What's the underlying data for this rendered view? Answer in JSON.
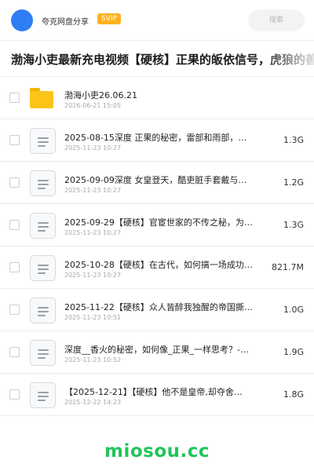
{
  "header": {
    "brand": "夸克网盘分享",
    "badge": "SVIP",
    "search_placeholder": "搜索"
  },
  "share": {
    "title": "渤海小吏最新充电视频【硬核】正果的皈依信号，虎狼的善"
  },
  "files": [
    {
      "type": "folder",
      "name": "渤海小吏26.06.21",
      "date": "2026-06-21 15:05",
      "size": ""
    },
    {
      "type": "file",
      "name": "2025-08-15深度 正果的秘密，雷部和雨部，…",
      "date": "2025-11-23 10:27",
      "size": "1.3G"
    },
    {
      "type": "file",
      "name": "2025-09-09深度 女皇登天，酷吏脏手套戴与…",
      "date": "2025-11-23 10:27",
      "size": "1.2G"
    },
    {
      "type": "file",
      "name": "2025-09-29【硬核】官宦世家的不传之秘，为…",
      "date": "2025-11-23 10:27",
      "size": "1.3G"
    },
    {
      "type": "file",
      "name": "2025-10-28【硬核】在古代，如何搞一场成功…",
      "date": "2025-11-23 10:27",
      "size": "821.7M"
    },
    {
      "type": "file",
      "name": "2025-11-22【硬核】众人皆醉我独醒的帝国撕…",
      "date": "2025-11-23 10:51",
      "size": "1.0G"
    },
    {
      "type": "file",
      "name": "深度__香火的秘密，如何像_正果_一样思考？-…",
      "date": "2025-11-23 10:52",
      "size": "1.9G"
    },
    {
      "type": "file",
      "name": "【2025-12-21】【硬核】他不是皇帝,却夺舍…",
      "date": "2025-12-22 14:23",
      "size": "1.8G"
    }
  ],
  "watermark": "miosou.cc"
}
